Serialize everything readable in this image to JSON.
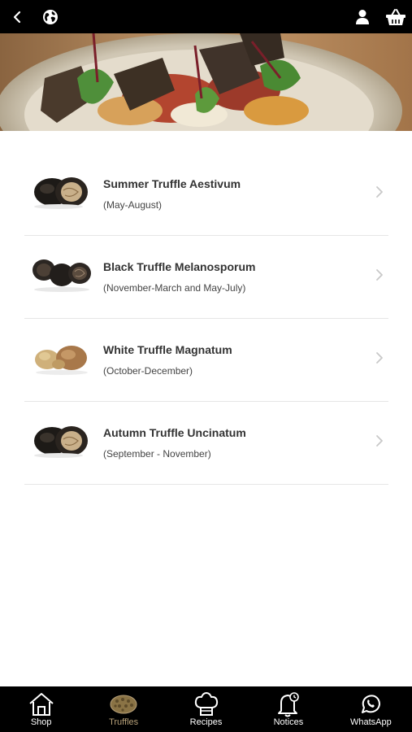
{
  "topbar": {
    "icons": [
      "chevron-left-icon",
      "globe-icon",
      "user-icon",
      "basket-icon"
    ]
  },
  "colors": {
    "bar": "#000000",
    "active_tab": "#b9a27a",
    "divider": "#e6e6e6",
    "chevron": "#c8c8c8"
  },
  "truffles": [
    {
      "name": "Summer Truffle Aestivum",
      "season": "(May-August)",
      "thumb": "dark-truffle-cut"
    },
    {
      "name": "Black Truffle Melanosporum",
      "season": "(November-March and May-July)",
      "thumb": "black-truffle-cut"
    },
    {
      "name": "White Truffle Magnatum",
      "season": "(October-December)",
      "thumb": "white-truffle"
    },
    {
      "name": "Autumn Truffle Uncinatum",
      "season": "(September - November)",
      "thumb": "dark-truffle-cut"
    }
  ],
  "nav": {
    "items": [
      {
        "label": "Shop",
        "icon": "shop-icon",
        "active": false
      },
      {
        "label": "Truffles",
        "icon": "truffle-icon",
        "active": true
      },
      {
        "label": "Recipes",
        "icon": "chef-hat-icon",
        "active": false
      },
      {
        "label": "Notices",
        "icon": "bell-icon",
        "active": false
      },
      {
        "label": "WhatsApp",
        "icon": "whatsapp-icon",
        "active": false
      }
    ]
  }
}
